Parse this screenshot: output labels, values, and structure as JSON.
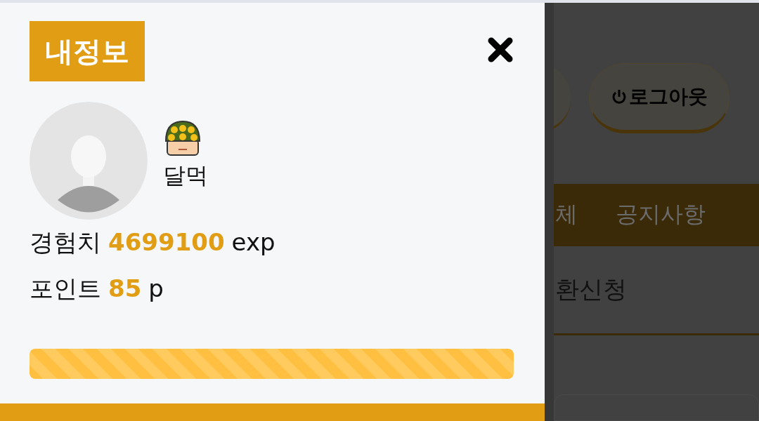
{
  "drawer": {
    "title": "내정보",
    "user": {
      "name": "달먹"
    },
    "stats": [
      {
        "label": "경험치",
        "value": "4699100",
        "unit": "exp"
      },
      {
        "label": "포인트",
        "value": "85",
        "unit": "p"
      }
    ],
    "progress": {
      "level": 1
    }
  },
  "background": {
    "logout_button": "로그아웃",
    "nav": [
      "체",
      "공지사항"
    ],
    "menu_item": "환신청"
  }
}
